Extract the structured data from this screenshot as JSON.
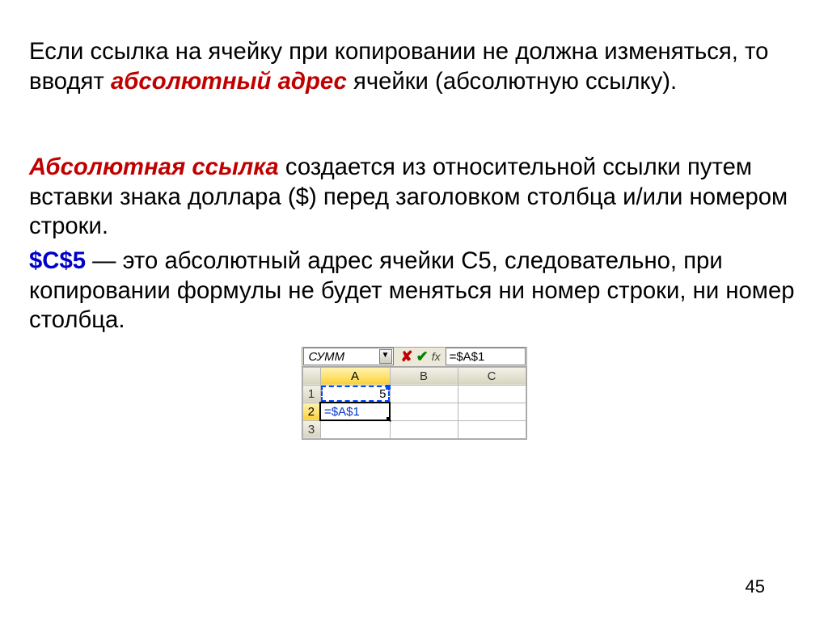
{
  "paragraph1": {
    "pre": "Если ссылка на ячейку при копировании не должна изменяться, то вводят ",
    "term": "абсолютный адрес",
    "post": " ячейки (абсолютную ссылку)."
  },
  "paragraph2": {
    "term": "Абсолютная ссылка",
    "post": " создается из относительной ссылки путем вставки знака доллара ($) перед заголовком столбца и/или номером строки."
  },
  "paragraph3": {
    "ref": "$C$5",
    "post": " — это абсолютный адрес ячейки С5, следовательно, при копировании формулы не будет меняться ни номер строки, ни номер столбца."
  },
  "excel": {
    "namebox": "СУММ",
    "dropdown_glyph": "▼",
    "cancel_glyph": "✘",
    "confirm_glyph": "✔",
    "fx_label": "fx",
    "formula": "=$A$1",
    "columns": {
      "A": "A",
      "B": "B",
      "C": "C"
    },
    "rows": {
      "1": "1",
      "2": "2",
      "3": "3"
    },
    "cellA1": "5",
    "cellA2": "=$A$1"
  },
  "page_number": "45"
}
